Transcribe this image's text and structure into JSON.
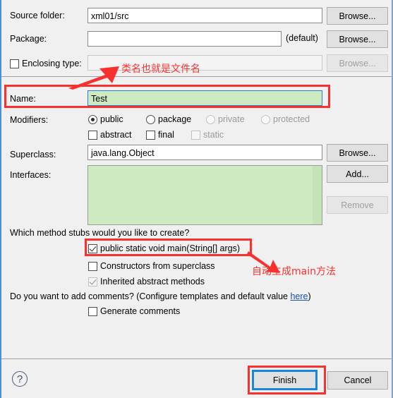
{
  "fields": {
    "source_folder": {
      "label": "Source folder:",
      "value": "xml01/src",
      "browse": "Browse..."
    },
    "package": {
      "label": "Package:",
      "value": "",
      "suffix": "(default)",
      "browse": "Browse..."
    },
    "enclosing_type": {
      "label": "Enclosing type:",
      "value": "",
      "browse": "Browse..."
    },
    "name": {
      "label": "Name:",
      "value": "Test"
    },
    "superclass": {
      "label": "Superclass:",
      "value": "java.lang.Object",
      "browse": "Browse..."
    },
    "interfaces": {
      "label": "Interfaces:",
      "add": "Add...",
      "remove": "Remove"
    }
  },
  "modifiers": {
    "label": "Modifiers:",
    "radios": [
      {
        "label": "public",
        "checked": true,
        "disabled": false
      },
      {
        "label": "package",
        "checked": false,
        "disabled": false
      },
      {
        "label": "private",
        "checked": false,
        "disabled": true
      },
      {
        "label": "protected",
        "checked": false,
        "disabled": true
      }
    ],
    "checkboxes": [
      {
        "label": "abstract",
        "checked": false,
        "disabled": false
      },
      {
        "label": "final",
        "checked": false,
        "disabled": false
      },
      {
        "label": "static",
        "checked": false,
        "disabled": true
      }
    ]
  },
  "method_stubs": {
    "question": "Which method stubs would you like to create?",
    "options": [
      {
        "label": "public static void main(String[] args)",
        "checked": true,
        "disabled": false
      },
      {
        "label": "Constructors from superclass",
        "checked": false,
        "disabled": false
      },
      {
        "label": "Inherited abstract methods",
        "checked": true,
        "disabled": true
      }
    ]
  },
  "comments": {
    "question_prefix": "Do you want to add comments? (Configure templates and default value ",
    "link": "here",
    "question_suffix": ")",
    "generate": {
      "label": "Generate comments",
      "checked": false
    }
  },
  "footer": {
    "help": "?",
    "finish": "Finish",
    "cancel": "Cancel"
  },
  "annotations": {
    "name_note": "类名也就是文件名",
    "main_note": "自动生成main方法"
  },
  "colors": {
    "accent_green": "#cdeac0",
    "focus_blue": "#1a86d8",
    "annotation_red": "#f8312f",
    "link_blue": "#1a4fb4",
    "dialog_bg": "#f0f0f0"
  }
}
